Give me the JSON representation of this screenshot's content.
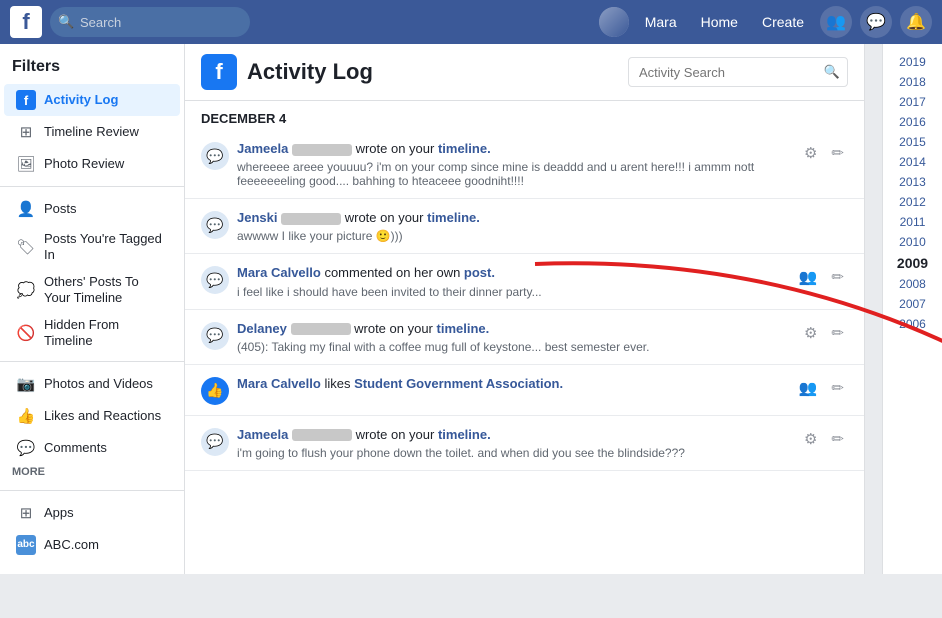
{
  "topnav": {
    "logo": "f",
    "search_placeholder": "Search",
    "user_name": "Mara",
    "nav_links": [
      "Home",
      "Create"
    ],
    "search_icon": "🔍"
  },
  "sidebar": {
    "title": "Filters",
    "items": [
      {
        "id": "activity-log",
        "label": "Activity Log",
        "icon": "fb",
        "active": true
      },
      {
        "id": "timeline-review",
        "label": "Timeline Review",
        "icon": "grid"
      },
      {
        "id": "photo-review",
        "label": "Photo Review",
        "icon": "photo"
      },
      {
        "id": "posts",
        "label": "Posts",
        "icon": "person"
      },
      {
        "id": "posts-tagged",
        "label": "Posts You're Tagged In",
        "icon": "tag"
      },
      {
        "id": "others-posts",
        "label": "Others' Posts To Your Timeline",
        "icon": "bubble"
      },
      {
        "id": "hidden",
        "label": "Hidden From Timeline",
        "icon": "clock"
      },
      {
        "id": "photos-videos",
        "label": "Photos and Videos",
        "icon": "photo2"
      },
      {
        "id": "likes",
        "label": "Likes and Reactions",
        "icon": "thumb"
      },
      {
        "id": "comments",
        "label": "Comments",
        "icon": "comment"
      }
    ],
    "more_label": "MORE",
    "bottom_items": [
      {
        "id": "apps",
        "label": "Apps",
        "icon": "apps"
      },
      {
        "id": "abc",
        "label": "ABC.com",
        "icon": "abc"
      }
    ]
  },
  "activity": {
    "header_logo": "f",
    "title": "Activity Log",
    "search_placeholder": "Activity Search",
    "date_section": "DECEMBER 4",
    "rows": [
      {
        "id": "row1",
        "actor": "Jameela",
        "actor_blurred": true,
        "action": "wrote on your",
        "target": "timeline.",
        "content": "whereeee areee youuuu? i'm on your comp since mine is deaddd and u arent here!!! i ammm nott feeeeeeeling good.... bahhing to hteaceee goodniht!!!!",
        "icon": "chat",
        "has_gear": true,
        "has_edit": true
      },
      {
        "id": "row2",
        "actor": "Jenski",
        "actor_blurred": true,
        "action": "wrote on your",
        "target": "timeline.",
        "content": "awwww I like your picture 🙂)))",
        "icon": "chat",
        "has_gear": false,
        "has_edit": false
      },
      {
        "id": "row3",
        "actor": "Mara Calvello",
        "actor_blurred": false,
        "action": "commented on her own",
        "target": "post.",
        "content": "i feel like i should have been invited to their dinner party...",
        "icon": "chat",
        "has_gear": false,
        "has_edit": true,
        "has_people": true
      },
      {
        "id": "row4",
        "actor": "Delaney",
        "actor_blurred": true,
        "action": "wrote on your",
        "target": "timeline.",
        "content": "(405): Taking my final with a coffee mug full of keystone... best semester ever.",
        "icon": "chat",
        "has_gear": true,
        "has_edit": true
      },
      {
        "id": "row5",
        "actor": "Mara Calvello",
        "actor_blurred": false,
        "action": "likes",
        "target": "Student Government Association.",
        "content": "",
        "icon": "thumbs",
        "icon_blue": true,
        "has_gear": false,
        "has_edit": true,
        "has_people": true
      },
      {
        "id": "row6",
        "actor": "Jameela",
        "actor_blurred": true,
        "action": "wrote on your",
        "target": "timeline.",
        "content": "i'm going to flush your phone down the toilet. and when did you see the blindside???",
        "icon": "chat",
        "has_gear": true,
        "has_edit": true
      }
    ]
  },
  "years": {
    "items": [
      "2019",
      "2018",
      "2017",
      "2016",
      "2015",
      "2014",
      "2013",
      "2012",
      "2011",
      "2010",
      "2009",
      "2008",
      "2007",
      "2006"
    ],
    "active": "2009"
  }
}
